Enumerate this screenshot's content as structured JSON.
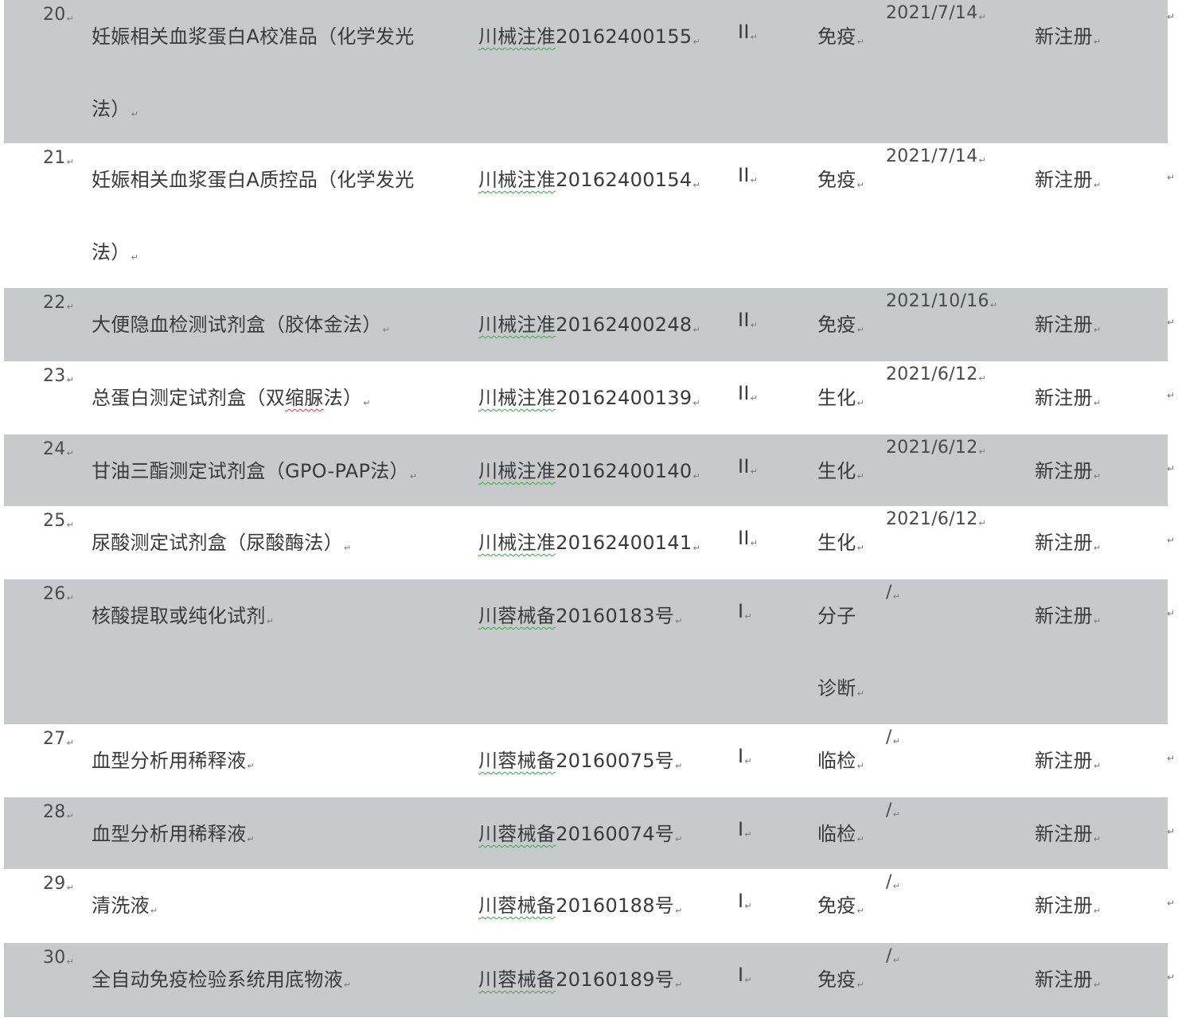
{
  "para_mark": "↵",
  "rows": [
    {
      "num": "20",
      "name": [
        "妊娠相关血浆蛋白A校准品（化学发光",
        "法）"
      ],
      "reg_prefix": "川械注准",
      "reg_number": "20162400155",
      "cls": "II",
      "category": [
        "免疫"
      ],
      "date": "2021/7/14",
      "type": "新注册"
    },
    {
      "num": "21",
      "name": [
        "妊娠相关血浆蛋白A质控品（化学发光",
        "法）"
      ],
      "reg_prefix": "川械注准",
      "reg_number": "20162400154",
      "cls": "II",
      "category": [
        "免疫"
      ],
      "date": "2021/7/14",
      "type": "新注册"
    },
    {
      "num": "22",
      "name": [
        "大便隐血检测试剂盒（胶体金法）"
      ],
      "reg_prefix": "川械注准",
      "reg_number": "20162400248",
      "cls": "II",
      "category": [
        "免疫"
      ],
      "date": "2021/10/16",
      "type": "新注册"
    },
    {
      "num": "23",
      "name_parts": [
        "总蛋白测定试剂盒（双",
        "缩脲",
        "法）"
      ],
      "reg_prefix": "川械注准",
      "reg_number": "20162400139",
      "cls": "II",
      "category": [
        "生化"
      ],
      "date": "2021/6/12",
      "type": "新注册"
    },
    {
      "num": "24",
      "name": [
        "甘油三酯测定试剂盒（GPO-PAP法）"
      ],
      "reg_prefix": "川械注准",
      "reg_number": "20162400140",
      "cls": "II",
      "category": [
        "生化"
      ],
      "date": "2021/6/12",
      "type": "新注册"
    },
    {
      "num": "25",
      "name": [
        "尿酸测定试剂盒（尿酸酶法）"
      ],
      "reg_prefix": "川械注准",
      "reg_number": "20162400141",
      "cls": "II",
      "category": [
        "生化"
      ],
      "date": "2021/6/12",
      "type": "新注册"
    },
    {
      "num": "26",
      "name": [
        "核酸提取或纯化试剂"
      ],
      "reg_prefix": "川蓉械备",
      "reg_number": "20160183号",
      "cls": "I",
      "category": [
        "分子",
        "诊断"
      ],
      "date": "/",
      "type": "新注册"
    },
    {
      "num": "27",
      "name": [
        "血型分析用稀释液"
      ],
      "reg_prefix": "川蓉械备",
      "reg_number": "20160075号",
      "cls": "I",
      "category": [
        "临检"
      ],
      "date": "/",
      "type": "新注册"
    },
    {
      "num": "28",
      "name": [
        "血型分析用稀释液"
      ],
      "reg_prefix": "川蓉械备",
      "reg_number": "20160074号",
      "cls": "I",
      "category": [
        "临检"
      ],
      "date": "/",
      "type": "新注册"
    },
    {
      "num": "29",
      "name": [
        "清洗液"
      ],
      "reg_prefix": "川蓉械备",
      "reg_number": "20160188号",
      "cls": "I",
      "category": [
        "免疫"
      ],
      "date": "/",
      "type": "新注册"
    },
    {
      "num": "30",
      "name": [
        "全自动免疫检验系统用底物液"
      ],
      "reg_prefix": "川蓉械备",
      "reg_number": "20160189号",
      "cls": "I",
      "category": [
        "免疫"
      ],
      "date": "/",
      "type": "新注册"
    }
  ]
}
